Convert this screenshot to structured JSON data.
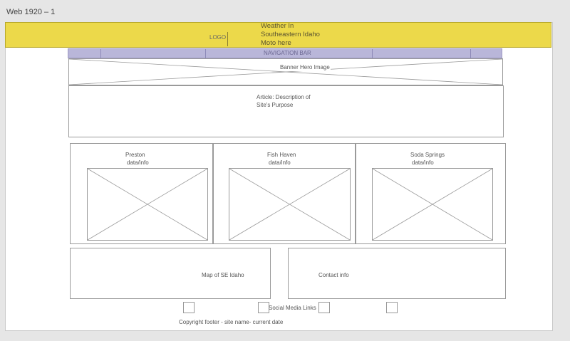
{
  "frame": {
    "label": "Web 1920 – 1"
  },
  "header": {
    "logo_label": "LOGO",
    "title_lines": [
      "Weather In",
      "Southeastern Idaho",
      "Moto here"
    ]
  },
  "nav": {
    "label": "NAVIGATION BAR"
  },
  "banner": {
    "label": "Banner Hero Image"
  },
  "article": {
    "lines": [
      "Article: Description of",
      "Site's Purpose"
    ]
  },
  "cities": [
    {
      "name": "Preston",
      "sub": "data/info"
    },
    {
      "name": "Fish Haven",
      "sub": "data/info"
    },
    {
      "name": "Soda Springs",
      "sub": "data/info"
    }
  ],
  "map": {
    "label": "Map of SE Idaho"
  },
  "contact": {
    "label": "Contact info"
  },
  "social": {
    "label": "Social Media Links"
  },
  "footer": {
    "copyright": "Copyright footer - site name- current date"
  },
  "colors": {
    "header": "#ecd94a",
    "nav": "#b9b6d9",
    "wire": "#9a9a9a"
  }
}
